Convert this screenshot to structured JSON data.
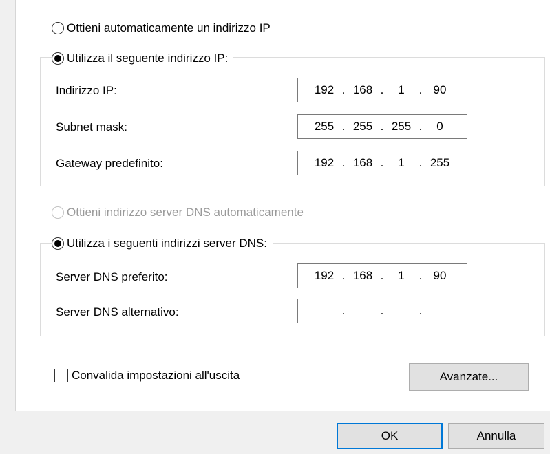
{
  "ip_mode": {
    "auto_label": "Ottieni automaticamente un indirizzo IP",
    "manual_label": "Utilizza il seguente indirizzo IP:"
  },
  "ip_fields": {
    "ip_label": "Indirizzo IP:",
    "ip": [
      "192",
      "168",
      "1",
      "90"
    ],
    "mask_label": "Subnet mask:",
    "mask": [
      "255",
      "255",
      "255",
      "0"
    ],
    "gateway_label": "Gateway predefinito:",
    "gateway": [
      "192",
      "168",
      "1",
      "255"
    ]
  },
  "dns_mode": {
    "auto_label": "Ottieni indirizzo server DNS automaticamente",
    "manual_label": "Utilizza i seguenti indirizzi server DNS:"
  },
  "dns_fields": {
    "preferred_label": "Server DNS preferito:",
    "preferred": [
      "192",
      "168",
      "1",
      "90"
    ],
    "alternate_label": "Server DNS alternativo:",
    "alternate": [
      "",
      "",
      "",
      ""
    ]
  },
  "validate": {
    "label": "Convalida impostazioni all'uscita"
  },
  "buttons": {
    "advanced": "Avanzate...",
    "ok": "OK",
    "cancel": "Annulla"
  },
  "colors": {
    "accent": "#0078d7",
    "dialog_bg": "#f0f0f0",
    "panel_bg": "#ffffff"
  }
}
